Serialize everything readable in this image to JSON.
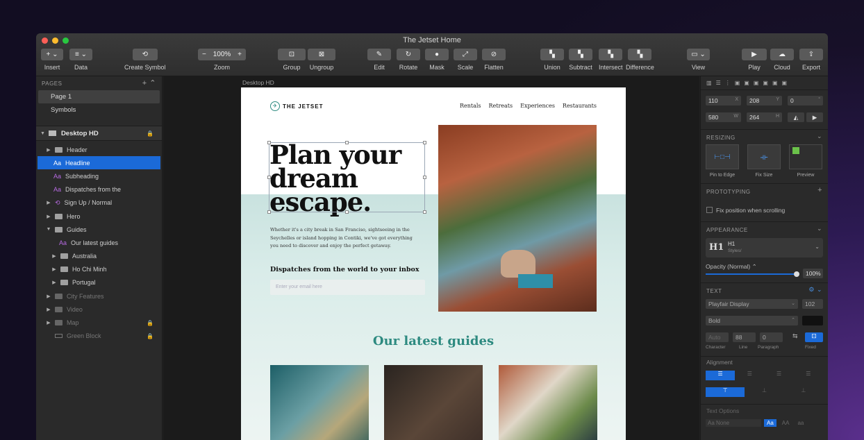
{
  "window": {
    "title": "The Jetset Home"
  },
  "toolbar": {
    "insert": "Insert",
    "data": "Data",
    "create_symbol": "Create Symbol",
    "zoom": "Zoom",
    "zoom_value": "100%",
    "group": "Group",
    "ungroup": "Ungroup",
    "edit": "Edit",
    "rotate": "Rotate",
    "mask": "Mask",
    "scale": "Scale",
    "flatten": "Flatten",
    "union": "Union",
    "subtract": "Subtract",
    "intersect": "Intersect",
    "difference": "Difference",
    "view": "View",
    "play": "Play",
    "cloud": "Cloud",
    "export": "Export"
  },
  "pages": {
    "header": "PAGES",
    "items": [
      "Page 1",
      "Symbols"
    ]
  },
  "layers": {
    "artboard": "Desktop HD",
    "items": [
      "Header",
      "Headline",
      "Subheading",
      "Dispatches from the",
      "Sign Up / Normal",
      "Hero",
      "Guides",
      "Our latest guides",
      "Australia",
      "Ho Chi Minh",
      "Portugal",
      "City Features",
      "Video",
      "Map",
      "Green Block"
    ]
  },
  "canvas": {
    "artboard_label": "Desktop HD"
  },
  "site": {
    "logo": "THE JETSET",
    "nav": [
      "Rentals",
      "Retreats",
      "Experiences",
      "Restaurants"
    ],
    "headline": "Plan your dream escape.",
    "body": "Whether it's a city break in San Franciso, sightseeing in the Seychelles or island hopping in Contiki, we've got everything you need to discover and enjoy the perfect getaway.",
    "dispatches": "Dispatches from the world to your inbox",
    "email_placeholder": "Enter your email here",
    "guides_title": "Our latest guides"
  },
  "inspector": {
    "x": "110",
    "x_l": "X",
    "y": "208",
    "y_l": "Y",
    "rot": "0",
    "rot_l": "°",
    "w": "580",
    "w_l": "W",
    "h": "264",
    "h_l": "H",
    "resizing": "RESIZING",
    "pin_to_edge": "Pin to Edge",
    "fix_size": "Fix Size",
    "preview": "Preview",
    "prototyping": "PROTOTYPING",
    "fix_scroll": "Fix position when scrolling",
    "appearance": "APPEARANCE",
    "style_name": "H1",
    "style_sub": "Styles/",
    "style_glyph": "H1",
    "opacity": "Opacity (Normal) ⌃",
    "opacity_val": "100%",
    "text": "TEXT",
    "font": "Playfair Display",
    "font_size": "102",
    "weight": "Bold",
    "char": "Auto",
    "line": "88",
    "para": "0",
    "char_l": "Character",
    "line_l": "Line",
    "para_l": "Paragraph",
    "fixed_l": "Fixed",
    "alignment": "Alignment",
    "text_options": "Text Options",
    "aa_none": "Aa None",
    "aa1": "Aa",
    "aa2": "AA",
    "aa3": "aa"
  },
  "colors": {
    "accent": "#1b6ad8",
    "teal": "#2d8a80"
  }
}
